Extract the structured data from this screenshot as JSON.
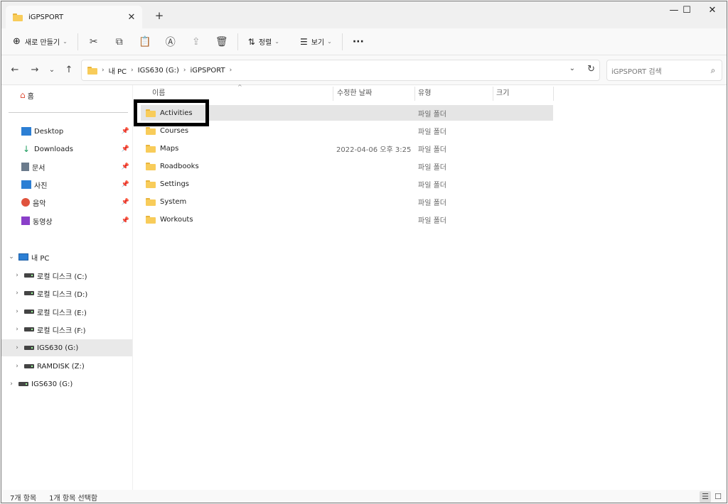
{
  "tab": {
    "title": "iGPSPORT",
    "close": "✕",
    "new_tab": "+"
  },
  "window_controls": {
    "minimize": "—",
    "maximize": "☐",
    "close": "✕"
  },
  "toolbar": {
    "new_label": "새로 만들기",
    "sort_label": "정렬",
    "view_label": "보기",
    "more": "···"
  },
  "nav": {
    "back": "←",
    "forward": "→",
    "recent": "⌄",
    "up": "↑"
  },
  "address": {
    "crumbs": [
      "내 PC",
      "IGS630 (G:)",
      "iGPSPORT"
    ],
    "sep": "›"
  },
  "search": {
    "placeholder": "iGPSPORT 검색",
    "icon": "search-icon"
  },
  "sidebar": {
    "home": "홈",
    "quick": [
      {
        "label": "Desktop",
        "icon": "desktop-icon",
        "color": "#2c7fd4"
      },
      {
        "label": "Downloads",
        "icon": "download-icon",
        "color": "#1a9a5b"
      },
      {
        "label": "문서",
        "icon": "document-icon",
        "color": "#6b7b8c"
      },
      {
        "label": "사진",
        "icon": "pictures-icon",
        "color": "#2c7fd4"
      },
      {
        "label": "음악",
        "icon": "music-icon",
        "color": "#e0533d"
      },
      {
        "label": "동영상",
        "icon": "video-icon",
        "color": "#8a3fc9"
      }
    ],
    "pin": "📌",
    "this_pc": "내 PC",
    "drives": [
      "로컬 디스크 (C:)",
      "로컬 디스크 (D:)",
      "로컬 디스크 (E:)",
      "로컬 디스크 (F:)",
      "IGS630 (G:)",
      "RAMDISK (Z:)"
    ],
    "external": "IGS630 (G:)"
  },
  "columns": {
    "name": "이름",
    "date": "수정한 날짜",
    "type": "유형",
    "size": "크기",
    "sort_caret": "^"
  },
  "rows": [
    {
      "name": "Activities",
      "date": "",
      "type": "파일 폴더"
    },
    {
      "name": "Courses",
      "date": "",
      "type": "파일 폴더"
    },
    {
      "name": "Maps",
      "date": "2022-04-06 오후 3:25",
      "type": "파일 폴더"
    },
    {
      "name": "Roadbooks",
      "date": "",
      "type": "파일 폴더"
    },
    {
      "name": "Settings",
      "date": "",
      "type": "파일 폴더"
    },
    {
      "name": "System",
      "date": "",
      "type": "파일 폴더"
    },
    {
      "name": "Workouts",
      "date": "",
      "type": "파일 폴더"
    }
  ],
  "status": {
    "count": "7개 항목",
    "selected": "1개 항목 선택함"
  }
}
